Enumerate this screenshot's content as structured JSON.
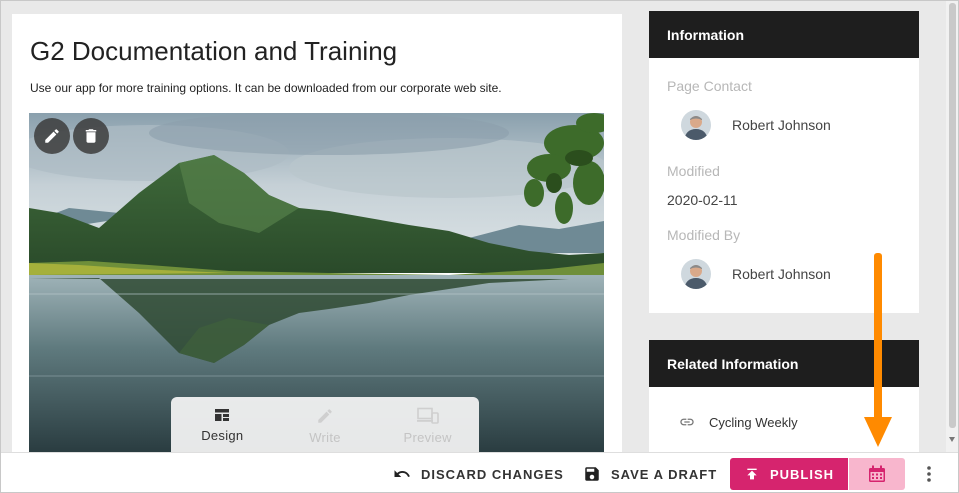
{
  "main": {
    "title": "G2 Documentation and Training",
    "description": "Use our app for more training options. It can be downloaded from our corporate web site.",
    "image_actions": {
      "edit_icon": "pencil-icon",
      "delete_icon": "trash-icon"
    },
    "modes": [
      {
        "label": "Design",
        "icon": "layout-icon",
        "state": "active"
      },
      {
        "label": "Write",
        "icon": "pencil-icon",
        "state": "disabled"
      },
      {
        "label": "Preview",
        "icon": "devices-icon",
        "state": "disabled"
      }
    ]
  },
  "sidebar": {
    "information": {
      "heading": "Information",
      "page_contact_label": "Page Contact",
      "page_contact_name": "Robert Johnson",
      "modified_label": "Modified",
      "modified_value": "2020-02-11",
      "modified_by_label": "Modified By",
      "modified_by_name": "Robert Johnson"
    },
    "related": {
      "heading": "Related Information",
      "items": [
        {
          "label": "Cycling Weekly",
          "icon": "link-icon"
        }
      ]
    }
  },
  "toolbar": {
    "discard_label": "DISCARD CHANGES",
    "draft_label": "SAVE A DRAFT",
    "publish_label": "PUBLISH",
    "schedule_icon": "calendar-icon",
    "more_icon": "more-vertical-icon"
  },
  "colors": {
    "publish": "#d6246e",
    "schedule": "#f8b6cd",
    "card_header": "#1e1e1e",
    "annotation_arrow": "#ff8a00"
  }
}
